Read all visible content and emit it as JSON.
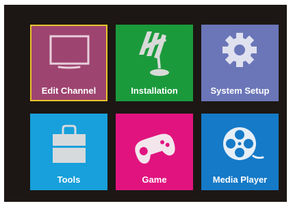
{
  "menu": {
    "tiles": [
      {
        "label": "Edit Channel",
        "icon": "tv-icon",
        "color": "#9e4470",
        "selected": true
      },
      {
        "label": "Installation",
        "icon": "satellite-dish-icon",
        "color": "#1b9a3c",
        "selected": false
      },
      {
        "label": "System Setup",
        "icon": "gear-icon",
        "color": "#6b76b8",
        "selected": false
      },
      {
        "label": "Tools",
        "icon": "toolbox-icon",
        "color": "#17a0db",
        "selected": false
      },
      {
        "label": "Game",
        "icon": "gamepad-icon",
        "color": "#e1147f",
        "selected": false
      },
      {
        "label": "Media Player",
        "icon": "film-reel-icon",
        "color": "#157ac8",
        "selected": false
      }
    ]
  },
  "colors": {
    "background": "#1c1714",
    "selection_border": "#e9c62a",
    "icon_light": "#ffffff"
  }
}
